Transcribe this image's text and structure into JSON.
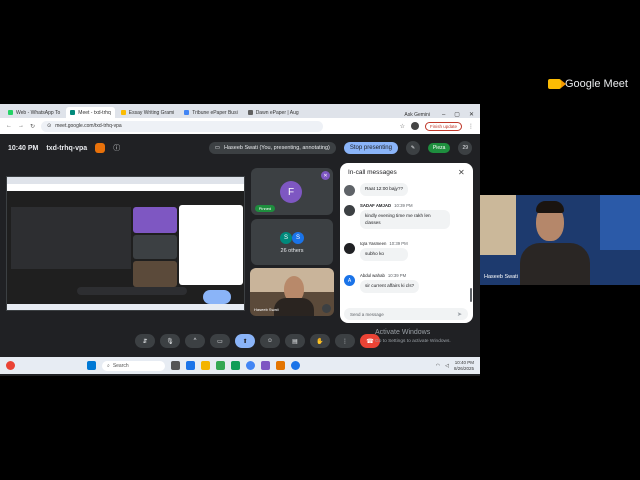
{
  "brand": {
    "logo_text": "Google Meet"
  },
  "browser": {
    "tabs": [
      {
        "label": "Web - WhatsApp To",
        "color": "#25d366"
      },
      {
        "label": "Meet - txd-trhq",
        "color": "#00897b"
      },
      {
        "label": "Essay Writing Grami",
        "color": "#fbbc04"
      },
      {
        "label": "Tribune ePaper Busi",
        "color": "#4285f4"
      },
      {
        "label": "Dawn ePaper | Aug",
        "color": "#616161"
      }
    ],
    "ask_gemini": "Ask Gemini",
    "url": "meet.google.com/txd-trhq-vpa",
    "finish_update": "Finish update"
  },
  "meeting": {
    "time": "10:40 PM",
    "code": "txd-trhq-vpa",
    "presenting_label": "Haseeb Swati (You, presenting, annotating)",
    "stop_presenting": "Stop presenting",
    "pill_label": "Pieza",
    "participant_count": "29"
  },
  "tiles": {
    "f_initial": "F",
    "pinned": "Pinned",
    "others_initials": [
      "S",
      "S"
    ],
    "others_label": "26 others",
    "self_label": "Haseeb Swati"
  },
  "chat": {
    "title": "In-call messages",
    "messages": [
      {
        "sender": "",
        "time": "",
        "text": "Raat 12:00 bajy??",
        "avatar": "#5f6368"
      },
      {
        "sender": "SADAF AMJAD",
        "time": "10:39 PM",
        "text": "kindly evening time me rakh len classes",
        "avatar": "#3c4043"
      },
      {
        "sender": "Iqra Yasmeen",
        "time": "10:39 PM",
        "text": "subho ko",
        "avatar": "#202124"
      },
      {
        "sender": "Abdul wahab",
        "time": "10:39 PM",
        "text": "sir current affairs ki cls?",
        "avatar": "#1a73e8",
        "initial": "A"
      }
    ],
    "input_placeholder": "Send a message"
  },
  "windows": {
    "activate_title": "Activate Windows",
    "activate_sub": "Go to Settings to activate Windows.",
    "search_label": "Search",
    "time": "10:40 PM",
    "date": "8/26/2025"
  },
  "camera": {
    "name": "Haseeb Swati"
  }
}
